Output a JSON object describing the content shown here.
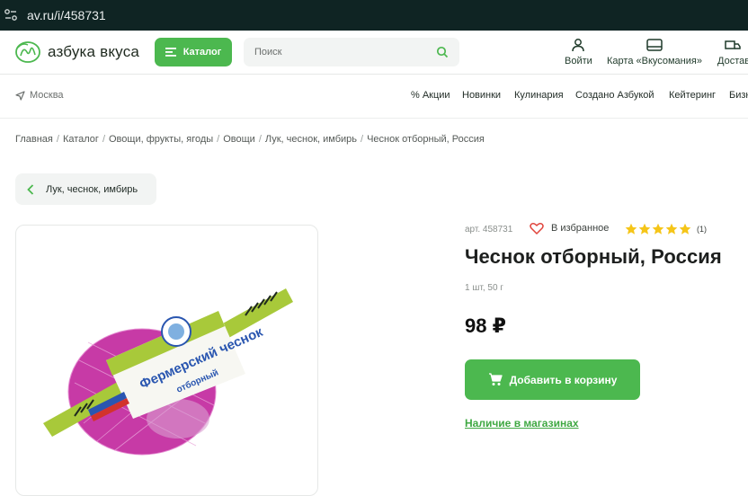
{
  "browser": {
    "url": "av.ru/i/458731"
  },
  "header": {
    "logo_text": "азбука вкуса",
    "catalog_label": "Каталог",
    "search_placeholder": "Поиск",
    "login_label": "Войти",
    "card_label": "Карта «Вкусомания»",
    "delivery_label": "Достав"
  },
  "nav": {
    "city": "Москва",
    "items": [
      "% Акции",
      "Новинки",
      "Кулинария",
      "Создано Азбукой",
      "Кейтеринг",
      "Бизн"
    ]
  },
  "breadcrumbs": [
    "Главная",
    "Каталог",
    "Овощи, фрукты, ягоды",
    "Овощи",
    "Лук, чеснок, имбирь",
    "Чеснок отборный, Россия"
  ],
  "back_label": "Лук, чеснок, имбирь",
  "product": {
    "article": "арт. 458731",
    "favorite_label": "В избранное",
    "rating": 5,
    "rating_max": 5,
    "reviews": "(1)",
    "title": "Чеснок отборный, Россия",
    "weight": "1 шт, 50 г",
    "price": "98 ₽",
    "add_to_cart_label": "Добавить в корзину",
    "availability_label": "Наличие в магазинах",
    "label_text_line1": "Фермерский чеснок",
    "label_text_line2": "отборный"
  },
  "colors": {
    "brand_green": "#4cb84f",
    "star": "#f5c518",
    "heart": "#e0443c",
    "net": "#c0399f"
  }
}
